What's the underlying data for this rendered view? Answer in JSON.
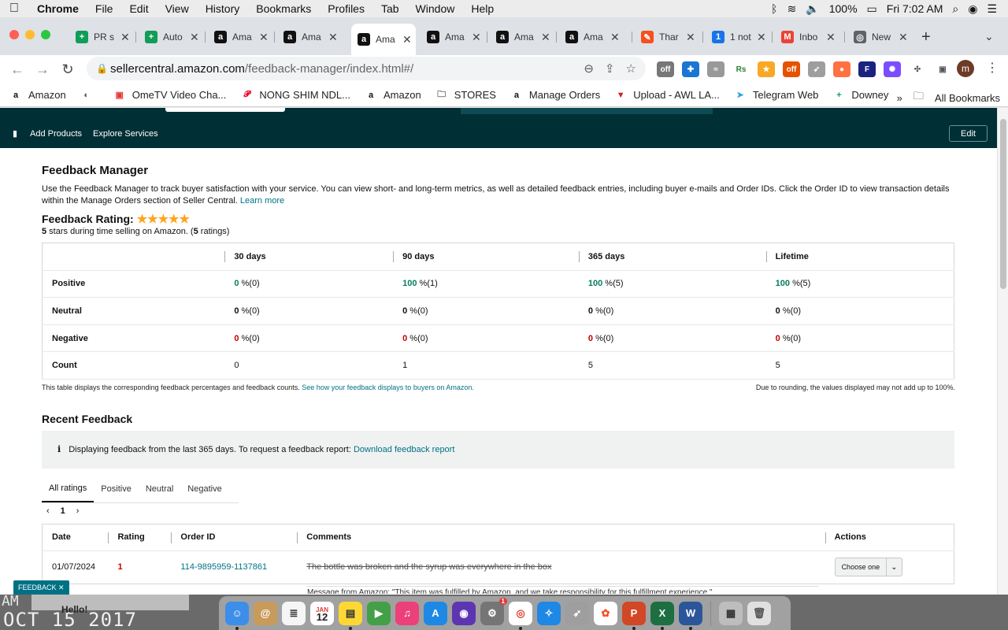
{
  "menubar": {
    "app": "Chrome",
    "items": [
      "File",
      "Edit",
      "View",
      "History",
      "Bookmarks",
      "Profiles",
      "Tab",
      "Window",
      "Help"
    ],
    "battery": "100%",
    "clock": "Fri 7:02 AM"
  },
  "tabs": [
    {
      "title": "PR s",
      "icon": "green-sheet-icon",
      "fav": "+",
      "color": "#0f9d58"
    },
    {
      "title": "Auto",
      "icon": "green-sheet-icon",
      "fav": "+",
      "color": "#0f9d58"
    },
    {
      "title": "Ama",
      "icon": "amazon-icon",
      "fav": "a",
      "color": "#111111"
    },
    {
      "title": "Ama",
      "icon": "amazon-icon",
      "fav": "a",
      "color": "#111111"
    },
    {
      "title": "Ama",
      "icon": "amazon-icon",
      "fav": "a",
      "color": "#111111",
      "active": true
    },
    {
      "title": "Ama",
      "icon": "amazon-icon",
      "fav": "a",
      "color": "#111111"
    },
    {
      "title": "Ama",
      "icon": "amazon-icon",
      "fav": "a",
      "color": "#111111"
    },
    {
      "title": "Ama",
      "icon": "amazon-icon",
      "fav": "a",
      "color": "#111111"
    },
    {
      "title": "Thar",
      "icon": "pencil-icon",
      "fav": "✎",
      "color": "#f4511e"
    },
    {
      "title": "1 not",
      "icon": "notification-icon",
      "fav": "1",
      "color": "#1a73e8"
    },
    {
      "title": "Inbo",
      "icon": "gmail-icon",
      "fav": "M",
      "color": "#ea4335"
    },
    {
      "title": "New",
      "icon": "chrome-icon",
      "fav": "◎",
      "color": "#5f6368"
    }
  ],
  "omnibox": {
    "host": "sellercentral.amazon.com",
    "path": "/feedback-manager/index.html#/"
  },
  "profile_initial": "m",
  "bookmarks": [
    {
      "label": "Amazon",
      "icon": "amazon-icon"
    },
    {
      "label": "",
      "icon": "globe-icon"
    },
    {
      "label": "OmeTV Video Cha...",
      "icon": "ometv-icon"
    },
    {
      "label": "NONG SHIM NDL...",
      "icon": "pinterest-icon"
    },
    {
      "label": "Amazon",
      "icon": "amazon-icon"
    },
    {
      "label": "STORES",
      "icon": "folder-icon"
    },
    {
      "label": "Manage Orders",
      "icon": "amazon-icon"
    },
    {
      "label": "Upload - AWL LA...",
      "icon": "awl-icon"
    },
    {
      "label": "Telegram Web",
      "icon": "telegram-icon"
    },
    {
      "label": "Downey",
      "icon": "green-sheet-icon"
    }
  ],
  "bookmarks_more": "»",
  "all_bookmarks": "All Bookmarks",
  "nav": {
    "links": [
      "Add Products",
      "Explore Services"
    ],
    "edit": "Edit"
  },
  "page": {
    "title": "Feedback Manager",
    "intro": "Use the Feedback Manager to track buyer satisfaction with your service. You can view short- and long-term metrics, as well as detailed feedback entries, including buyer e-mails and Order IDs. Click the Order ID to view transaction details within the Manage Orders section of Seller Central.",
    "learn_more": "Learn more",
    "rating_label": "Feedback Rating:",
    "stars": "★★★★★",
    "rating_stars": "5",
    "rating_sub_a": " stars during time selling on Amazon. (",
    "rating_count": "5",
    "rating_sub_b": " ratings)"
  },
  "metrics": {
    "headers": [
      "30 days",
      "90 days",
      "365 days",
      "Lifetime"
    ],
    "rows": [
      {
        "label": "Positive",
        "cells": [
          {
            "v": "0",
            "u": " %(0)",
            "c": "green"
          },
          {
            "v": "100",
            "u": " %(1)",
            "c": "green"
          },
          {
            "v": "100",
            "u": " %(5)",
            "c": "green"
          },
          {
            "v": "100",
            "u": " %(5)",
            "c": "green"
          }
        ]
      },
      {
        "label": "Neutral",
        "cells": [
          {
            "v": "0",
            "u": " %(0)",
            "c": "gray"
          },
          {
            "v": "0",
            "u": " %(0)",
            "c": "gray"
          },
          {
            "v": "0",
            "u": " %(0)",
            "c": "gray"
          },
          {
            "v": "0",
            "u": " %(0)",
            "c": "gray"
          }
        ]
      },
      {
        "label": "Negative",
        "cells": [
          {
            "v": "0",
            "u": " %(0)",
            "c": "red"
          },
          {
            "v": "0",
            "u": " %(0)",
            "c": "red"
          },
          {
            "v": "0",
            "u": " %(0)",
            "c": "red"
          },
          {
            "v": "0",
            "u": " %(0)",
            "c": "red"
          }
        ]
      },
      {
        "label": "Count",
        "cells": [
          {
            "v": "0",
            "u": "",
            "c": "plain"
          },
          {
            "v": "1",
            "u": "",
            "c": "plain"
          },
          {
            "v": "5",
            "u": "",
            "c": "plain"
          },
          {
            "v": "5",
            "u": "",
            "c": "plain"
          }
        ]
      }
    ],
    "note_left": "This table displays the corresponding feedback percentages and feedback counts.",
    "note_link": "See how your feedback displays to buyers on Amazon.",
    "note_right": "Due to rounding, the values displayed may not add up to 100%."
  },
  "recent": {
    "title": "Recent Feedback",
    "info_icon": "i",
    "info": "Displaying feedback from the last 365 days. To request a feedback report:",
    "info_link": "Download feedback report",
    "filters": [
      "All ratings",
      "Positive",
      "Neutral",
      "Negative"
    ],
    "page": "1",
    "columns": [
      "Date",
      "Rating",
      "Order ID",
      "Comments",
      "Actions"
    ],
    "rows": [
      {
        "date": "01/07/2024",
        "rating": "1",
        "order": "114-9895959-1137861",
        "comment": "The bottle was broken and the syrup was everywhere in the box",
        "action": "Choose one"
      }
    ],
    "partial": "Message from Amazon: \"This item was fulfilled by Amazon, and we take responsibility for this fulfillment experience.\""
  },
  "feedback_tab": "FEEDBACK ✕",
  "desktop": {
    "line1": "AM",
    "line2": "OCT 15 2017",
    "hello": "Hello!"
  },
  "dock_calendar": {
    "month": "JAN",
    "day": "12"
  },
  "dock_badge": "1",
  "colors": {
    "nav_bg": "#002f36",
    "link": "#007185",
    "positive": "#067d62",
    "negative": "#c40000",
    "star": "#ffa41c"
  }
}
